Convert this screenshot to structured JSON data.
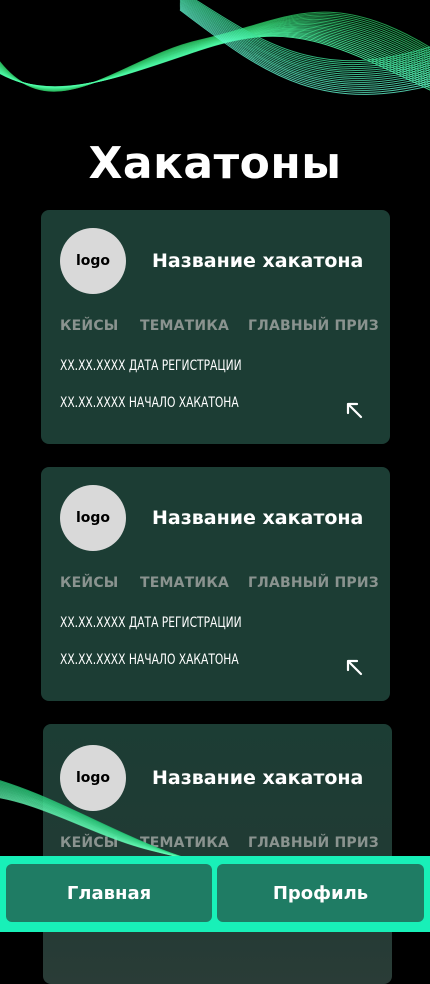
{
  "page_title": "Хакатоны",
  "colors": {
    "card_bg": "#1c3d34",
    "nav_bar": "#18f0b8",
    "nav_button": "#1f7c64",
    "wave": "#3cf08a"
  },
  "cards": [
    {
      "logo": "logo",
      "title": "Название хакатона",
      "tags": [
        "КЕЙСЫ",
        "ТЕМАТИКА",
        "ГЛАВНЫЙ ПРИЗ"
      ],
      "registration_date": "XX.XX.XXXX ДАТА РЕГИСТРАЦИИ",
      "start_date": "XX.XX.XXXX НАЧАЛО ХАКАТОНА",
      "open_icon": "arrow-up-left-icon"
    },
    {
      "logo": "logo",
      "title": "Название хакатона",
      "tags": [
        "КЕЙСЫ",
        "ТЕМАТИКА",
        "ГЛАВНЫЙ ПРИЗ"
      ],
      "registration_date": "XX.XX.XXXX ДАТА РЕГИСТРАЦИИ",
      "start_date": "XX.XX.XXXX НАЧАЛО ХАКАТОНА",
      "open_icon": "arrow-up-left-icon"
    },
    {
      "logo": "logo",
      "title": "Название хакатона",
      "tags": [
        "КЕЙСЫ",
        "ТЕМАТИКА",
        "ГЛАВНЫЙ ПРИЗ"
      ]
    }
  ],
  "nav": {
    "home_label": "Главная",
    "profile_label": "Профиль"
  }
}
